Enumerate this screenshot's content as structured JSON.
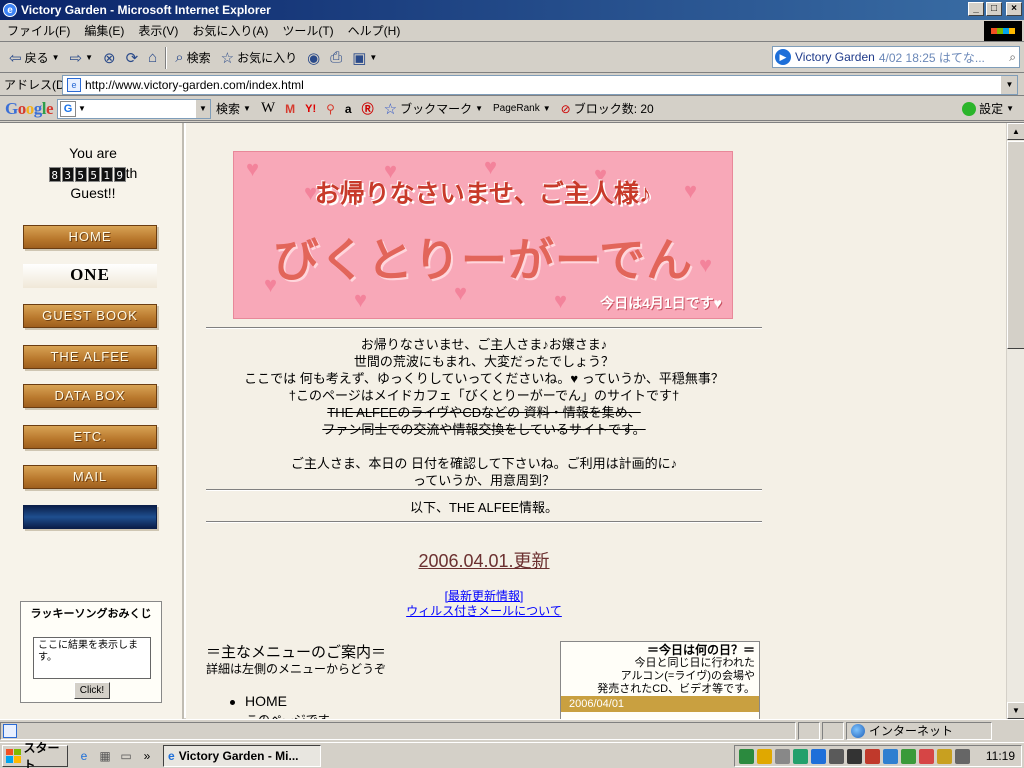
{
  "window": {
    "title": "Victory Garden - Microsoft Internet Explorer",
    "min": "_",
    "max": "□",
    "close": "×"
  },
  "menu": [
    "ファイル(F)",
    "編集(E)",
    "表示(V)",
    "お気に入り(A)",
    "ツール(T)",
    "ヘルプ(H)"
  ],
  "toolbar": {
    "back": "戻る",
    "search": "検索",
    "favorites": "お気に入り"
  },
  "news_box": {
    "site": "Victory Garden",
    "meta": "4/02 18:25 はてな..."
  },
  "address": {
    "label": "アドレス(D)",
    "url": "http://www.victory-garden.com/index.html"
  },
  "google_bar": {
    "logo": "Google",
    "search_label": "検索",
    "bookmarks": "ブックマーク",
    "pagerank": "PageRank",
    "blocked": "ブロック数: 20",
    "settings": "設定"
  },
  "sidebar": {
    "visitor_prefix": "You are",
    "visitor_digits": [
      "8",
      "3",
      "5",
      "5",
      "1",
      "9"
    ],
    "visitor_suffix": "th",
    "visitor_line3": "Guest!!",
    "nav": [
      "HOME",
      "ONE",
      "GUEST BOOK",
      "THE ALFEE",
      "DATA BOX",
      "ETC.",
      "MAIL"
    ],
    "omikuji_title": "ラッキーソングおみくじ",
    "omikuji_result": "ここに結果を表示します。",
    "omikuji_button": "Click!"
  },
  "hero": {
    "line1": "お帰りなさいませ、ご主人様♪",
    "line2": "びくとりーがーでん",
    "line3": "今日は4月1日です♥"
  },
  "intro": {
    "lines": [
      "お帰りなさいませ、ご主人さま♪お嬢さま♪",
      "世間の荒波にもまれ、大変だったでしょう？",
      "ここでは 何も考えず、ゆっくりしていってくださいね。♥ っていうか、平穏無事？",
      "†このページはメイドカフェ「びくとりーがーでん」のサイトです†"
    ],
    "strike_lines": [
      "THE ALFEEのライヴやCDなどの 資料・情報を集め、",
      "ファン同士での交流や情報交換をしているサイトです。"
    ],
    "date_lines": [
      "ご主人さま、本日の 日付を確認して下さいね。ご利用は計画的に♪",
      "っていうか、用意周到？"
    ]
  },
  "alfee_info": "以下、THE ALFEE情報。",
  "update": "2006.04.01.更新",
  "links": [
    "[最新更新情報]",
    "ウィルス付きメールについて"
  ],
  "main_menu": {
    "title": "＝主なメニューのご案内＝",
    "sub": "詳細は左側のメニューからどうぞ",
    "home": "HOME",
    "home_desc": "このページです。"
  },
  "today_box": {
    "title": "＝今日は何の日？＝",
    "lines": [
      "今日と同じ日に行われた",
      "アルコン(=ライヴ)の会場や",
      "発売されたCD、ビデオ等です。"
    ],
    "date": "2006/04/01"
  },
  "status": {
    "zone": "インターネット"
  },
  "taskbar": {
    "start": "スタート",
    "task": "Victory Garden - Mi...",
    "clock": "11:19"
  }
}
